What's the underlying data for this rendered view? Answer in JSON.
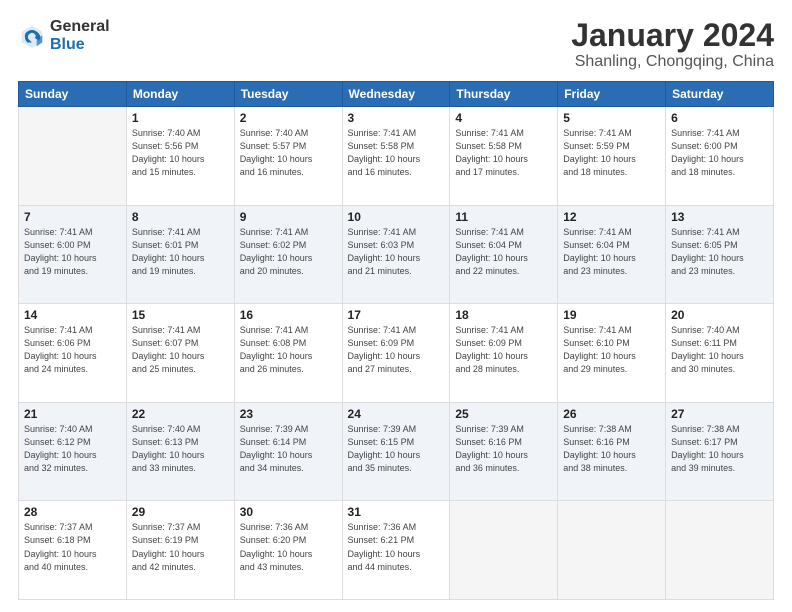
{
  "header": {
    "logo_general": "General",
    "logo_blue": "Blue",
    "title": "January 2024",
    "location": "Shanling, Chongqing, China"
  },
  "days_of_week": [
    "Sunday",
    "Monday",
    "Tuesday",
    "Wednesday",
    "Thursday",
    "Friday",
    "Saturday"
  ],
  "weeks": [
    [
      {
        "day": "",
        "info": ""
      },
      {
        "day": "1",
        "info": "Sunrise: 7:40 AM\nSunset: 5:56 PM\nDaylight: 10 hours\nand 15 minutes."
      },
      {
        "day": "2",
        "info": "Sunrise: 7:40 AM\nSunset: 5:57 PM\nDaylight: 10 hours\nand 16 minutes."
      },
      {
        "day": "3",
        "info": "Sunrise: 7:41 AM\nSunset: 5:58 PM\nDaylight: 10 hours\nand 16 minutes."
      },
      {
        "day": "4",
        "info": "Sunrise: 7:41 AM\nSunset: 5:58 PM\nDaylight: 10 hours\nand 17 minutes."
      },
      {
        "day": "5",
        "info": "Sunrise: 7:41 AM\nSunset: 5:59 PM\nDaylight: 10 hours\nand 18 minutes."
      },
      {
        "day": "6",
        "info": "Sunrise: 7:41 AM\nSunset: 6:00 PM\nDaylight: 10 hours\nand 18 minutes."
      }
    ],
    [
      {
        "day": "7",
        "info": "Sunrise: 7:41 AM\nSunset: 6:00 PM\nDaylight: 10 hours\nand 19 minutes."
      },
      {
        "day": "8",
        "info": "Sunrise: 7:41 AM\nSunset: 6:01 PM\nDaylight: 10 hours\nand 19 minutes."
      },
      {
        "day": "9",
        "info": "Sunrise: 7:41 AM\nSunset: 6:02 PM\nDaylight: 10 hours\nand 20 minutes."
      },
      {
        "day": "10",
        "info": "Sunrise: 7:41 AM\nSunset: 6:03 PM\nDaylight: 10 hours\nand 21 minutes."
      },
      {
        "day": "11",
        "info": "Sunrise: 7:41 AM\nSunset: 6:04 PM\nDaylight: 10 hours\nand 22 minutes."
      },
      {
        "day": "12",
        "info": "Sunrise: 7:41 AM\nSunset: 6:04 PM\nDaylight: 10 hours\nand 23 minutes."
      },
      {
        "day": "13",
        "info": "Sunrise: 7:41 AM\nSunset: 6:05 PM\nDaylight: 10 hours\nand 23 minutes."
      }
    ],
    [
      {
        "day": "14",
        "info": "Sunrise: 7:41 AM\nSunset: 6:06 PM\nDaylight: 10 hours\nand 24 minutes."
      },
      {
        "day": "15",
        "info": "Sunrise: 7:41 AM\nSunset: 6:07 PM\nDaylight: 10 hours\nand 25 minutes."
      },
      {
        "day": "16",
        "info": "Sunrise: 7:41 AM\nSunset: 6:08 PM\nDaylight: 10 hours\nand 26 minutes."
      },
      {
        "day": "17",
        "info": "Sunrise: 7:41 AM\nSunset: 6:09 PM\nDaylight: 10 hours\nand 27 minutes."
      },
      {
        "day": "18",
        "info": "Sunrise: 7:41 AM\nSunset: 6:09 PM\nDaylight: 10 hours\nand 28 minutes."
      },
      {
        "day": "19",
        "info": "Sunrise: 7:41 AM\nSunset: 6:10 PM\nDaylight: 10 hours\nand 29 minutes."
      },
      {
        "day": "20",
        "info": "Sunrise: 7:40 AM\nSunset: 6:11 PM\nDaylight: 10 hours\nand 30 minutes."
      }
    ],
    [
      {
        "day": "21",
        "info": "Sunrise: 7:40 AM\nSunset: 6:12 PM\nDaylight: 10 hours\nand 32 minutes."
      },
      {
        "day": "22",
        "info": "Sunrise: 7:40 AM\nSunset: 6:13 PM\nDaylight: 10 hours\nand 33 minutes."
      },
      {
        "day": "23",
        "info": "Sunrise: 7:39 AM\nSunset: 6:14 PM\nDaylight: 10 hours\nand 34 minutes."
      },
      {
        "day": "24",
        "info": "Sunrise: 7:39 AM\nSunset: 6:15 PM\nDaylight: 10 hours\nand 35 minutes."
      },
      {
        "day": "25",
        "info": "Sunrise: 7:39 AM\nSunset: 6:16 PM\nDaylight: 10 hours\nand 36 minutes."
      },
      {
        "day": "26",
        "info": "Sunrise: 7:38 AM\nSunset: 6:16 PM\nDaylight: 10 hours\nand 38 minutes."
      },
      {
        "day": "27",
        "info": "Sunrise: 7:38 AM\nSunset: 6:17 PM\nDaylight: 10 hours\nand 39 minutes."
      }
    ],
    [
      {
        "day": "28",
        "info": "Sunrise: 7:37 AM\nSunset: 6:18 PM\nDaylight: 10 hours\nand 40 minutes."
      },
      {
        "day": "29",
        "info": "Sunrise: 7:37 AM\nSunset: 6:19 PM\nDaylight: 10 hours\nand 42 minutes."
      },
      {
        "day": "30",
        "info": "Sunrise: 7:36 AM\nSunset: 6:20 PM\nDaylight: 10 hours\nand 43 minutes."
      },
      {
        "day": "31",
        "info": "Sunrise: 7:36 AM\nSunset: 6:21 PM\nDaylight: 10 hours\nand 44 minutes."
      },
      {
        "day": "",
        "info": ""
      },
      {
        "day": "",
        "info": ""
      },
      {
        "day": "",
        "info": ""
      }
    ]
  ]
}
